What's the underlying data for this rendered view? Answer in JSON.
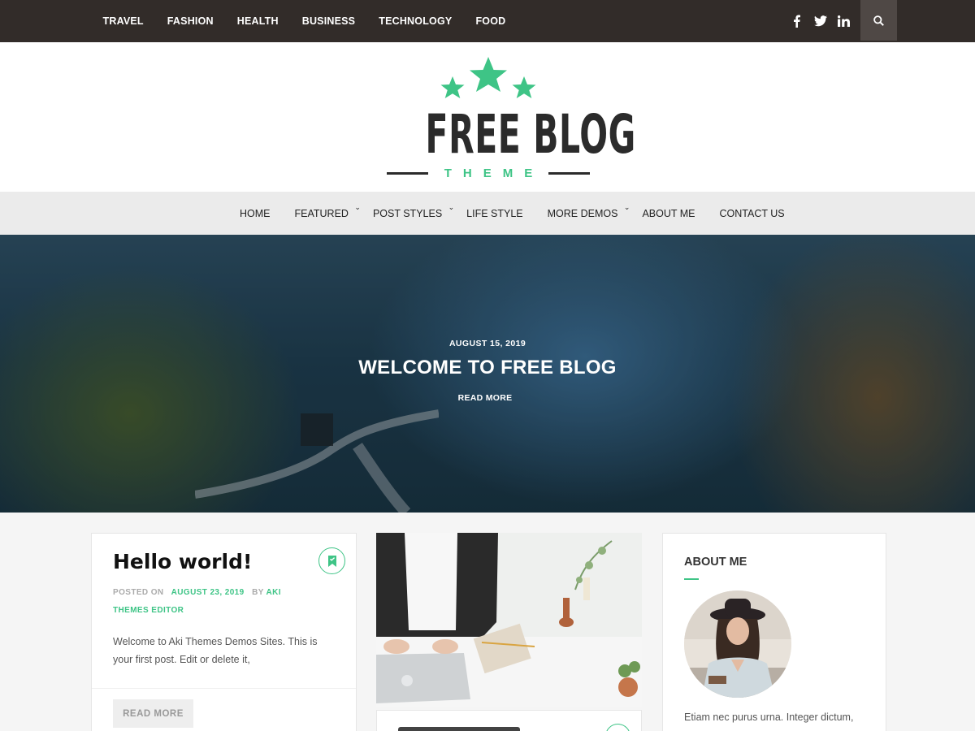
{
  "topbar": {
    "nav": [
      "TRAVEL",
      "FASHION",
      "HEALTH",
      "BUSINESS",
      "TECHNOLOGY",
      "FOOD"
    ],
    "social_icons": [
      "facebook-icon",
      "twitter-icon",
      "linkedin-icon"
    ],
    "search_icon": "search-icon"
  },
  "logo": {
    "title": "FREE BLOG",
    "subtitle": "THEME",
    "accent_color": "#3ec486"
  },
  "mainnav": {
    "items": [
      {
        "label": "HOME",
        "has_dropdown": false
      },
      {
        "label": "FEATURED",
        "has_dropdown": true
      },
      {
        "label": "POST STYLES",
        "has_dropdown": true
      },
      {
        "label": "LIFE STYLE",
        "has_dropdown": false
      },
      {
        "label": "MORE DEMOS",
        "has_dropdown": true
      },
      {
        "label": "ABOUT ME",
        "has_dropdown": false
      },
      {
        "label": "CONTACT US",
        "has_dropdown": false
      }
    ]
  },
  "hero": {
    "date": "AUGUST 15, 2019",
    "title": "WELCOME TO FREE BLOG",
    "read_more": "READ MORE"
  },
  "post1": {
    "title": "Hello world!",
    "posted_on_label": "POSTED ON",
    "date": "AUGUST 23, 2019",
    "by_label": "BY",
    "author": "AKI",
    "author_line2": "THEMES EDITOR",
    "excerpt": "Welcome to Aki Themes Demos Sites. This is your first post. Edit or delete it,",
    "read_more": "READ MORE"
  },
  "about": {
    "title": "ABOUT ME",
    "text": "Etiam nec purus urna. Integer dictum,"
  }
}
